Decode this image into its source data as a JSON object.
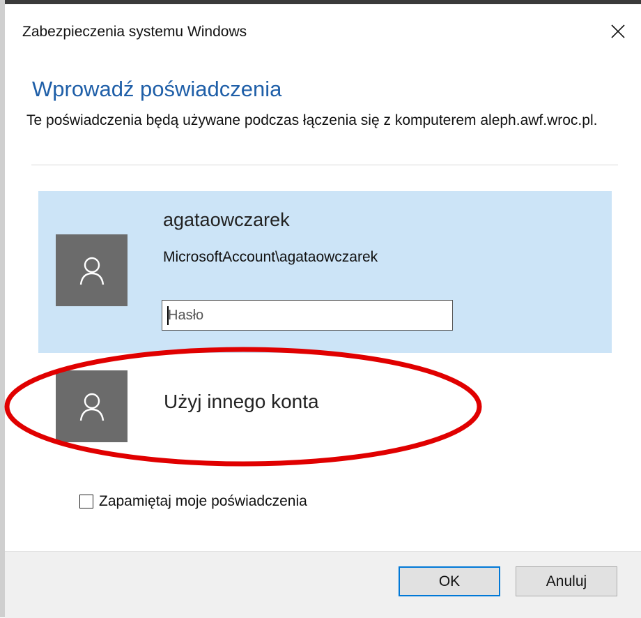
{
  "window": {
    "title": "Zabezpieczenia systemu Windows",
    "close_icon": "close-icon"
  },
  "dialog": {
    "heading": "Wprowadź poświadczenia",
    "description": "Te poświadczenia będą używane podczas łączenia się z komputerem aleph.awf.wroc.pl."
  },
  "account": {
    "name": "agataowczarek",
    "id": "MicrosoftAccount\\agataowczarek",
    "avatar_icon": "user-icon",
    "password": {
      "value": "",
      "placeholder": "Hasło"
    }
  },
  "other_account": {
    "label": "Użyj innego konta",
    "avatar_icon": "user-icon"
  },
  "remember": {
    "label": "Zapamiętaj moje poświadczenia",
    "checked": false
  },
  "buttons": {
    "ok": "OK",
    "cancel": "Anuluj"
  },
  "colors": {
    "heading": "#1f5fa8",
    "selected_card": "#cce4f7",
    "avatar_bg": "#6b6b6b",
    "annotation": "#e00000",
    "default_button_border": "#0078d7"
  }
}
